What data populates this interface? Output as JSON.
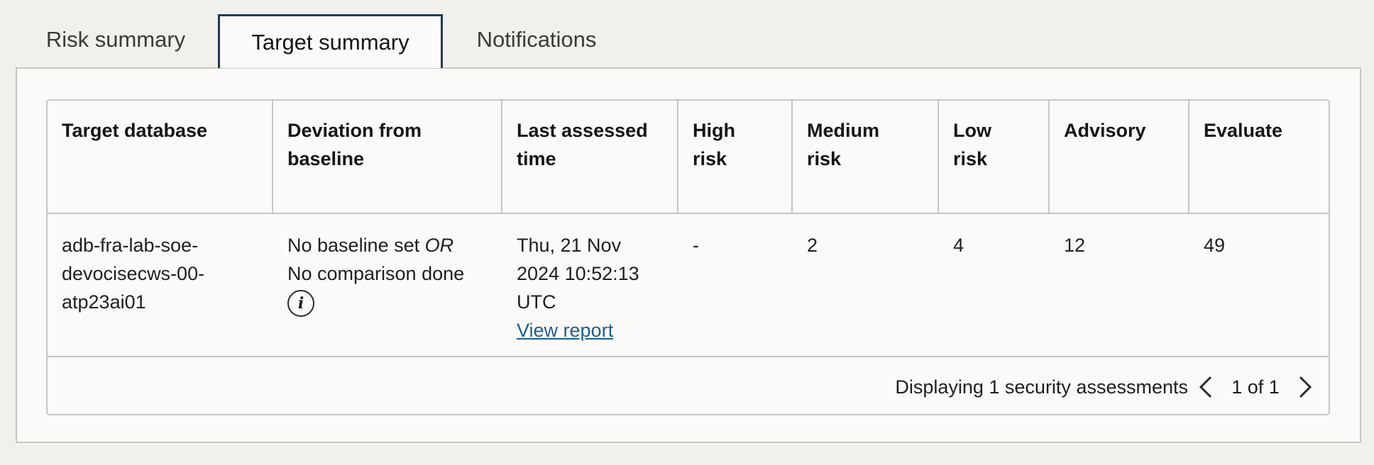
{
  "tabs": [
    {
      "label": "Risk summary",
      "selected": false
    },
    {
      "label": "Target summary",
      "selected": true
    },
    {
      "label": "Notifications",
      "selected": false
    }
  ],
  "table": {
    "headers": {
      "target_database": "Target database",
      "deviation_line1": "Deviation from",
      "deviation_line2": "baseline",
      "last_assessed_line1": "Last assessed",
      "last_assessed_line2": "time",
      "high_line1": "High",
      "high_line2": "risk",
      "medium_line1": "Medium",
      "medium_line2": "risk",
      "low_line1": "Low",
      "low_line2": "risk",
      "advisory": "Advisory",
      "evaluate": "Evaluate"
    },
    "rows": [
      {
        "target_line1": "adb-fra-lab-soe-",
        "target_line2": "devocisecws-00-",
        "target_line3": "atp23ai01",
        "deviation_text1": "No baseline set ",
        "deviation_or": "OR",
        "deviation_text2": "No comparison done",
        "last_line1": "Thu, 21 Nov",
        "last_line2": "2024 10:52:13",
        "last_line3": "UTC",
        "view_report": "View report",
        "high": "-",
        "medium": "2",
        "low": "4",
        "advisory": "12",
        "evaluate": "49"
      }
    ]
  },
  "footer": {
    "summary": "Displaying 1 security assessments",
    "page": "1 of 1"
  },
  "icons": {
    "info": "info-icon",
    "prev": "chevron-left-icon",
    "next": "chevron-right-icon"
  }
}
